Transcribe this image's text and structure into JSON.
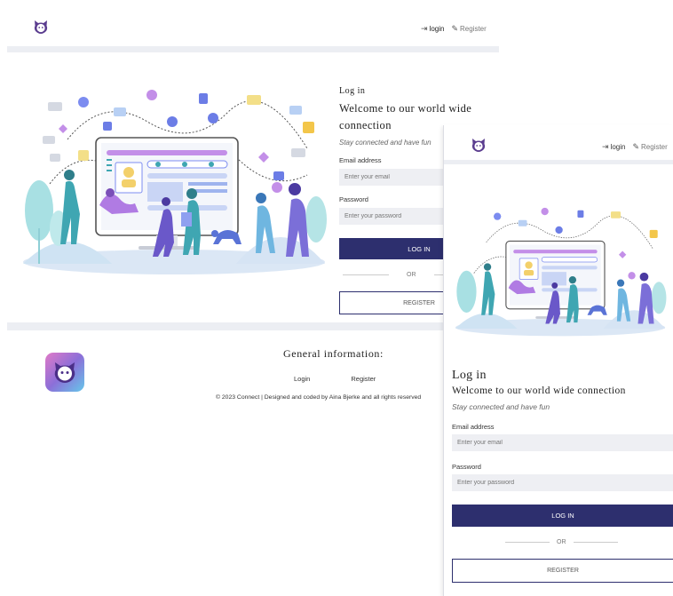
{
  "brand": {
    "logo_icon": "cat-face-icon",
    "color": "#5b3d8f",
    "accent": "#2d2f6e"
  },
  "nav": {
    "login_label": "login",
    "register_label": "Register",
    "login_icon": "sign-in-icon",
    "register_icon": "edit-icon"
  },
  "form": {
    "heading": "Log in",
    "welcome": "Welcome to our world wide connection",
    "tagline": "Stay connected and have fun",
    "email_label": "Email address",
    "email_placeholder": "Enter your email",
    "password_label": "Password",
    "password_placeholder": "Enter your password",
    "login_button": "LOG IN",
    "or_text": "OR",
    "register_button": "REGISTER"
  },
  "footer": {
    "title": "General information:",
    "links": [
      "Login",
      "Register"
    ],
    "copyright": "© 2023 Connect | Designed and coded by Aina Bjerke and all rights reserved"
  }
}
